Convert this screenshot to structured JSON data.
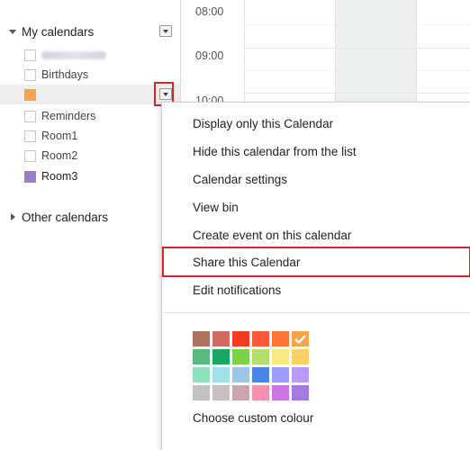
{
  "sidebar": {
    "my_calendars_label": "My calendars",
    "other_calendars_label": "Other calendars",
    "calendars": [
      {
        "label": "",
        "redacted": true,
        "color": "#ffffff"
      },
      {
        "label": "Birthdays",
        "color": "#ffffff"
      },
      {
        "label": "",
        "color": "#f6a44a"
      },
      {
        "label": "Reminders",
        "color": "#ffffff"
      },
      {
        "label": "Room1",
        "color": "#ffffff"
      },
      {
        "label": "Room2",
        "color": "#ffffff"
      },
      {
        "label": "Room3",
        "color": "#9a7fc4"
      }
    ]
  },
  "grid": {
    "times": [
      "08:00",
      "09:00",
      "10:00"
    ]
  },
  "menu": {
    "items": [
      "Display only this Calendar",
      "Hide this calendar from the list",
      "Calendar settings",
      "View bin",
      "Create event on this calendar",
      "Share this Calendar",
      "Edit notifications"
    ],
    "custom_colour_label": "Choose custom colour",
    "selected_color": "#f6a44a",
    "palette": [
      [
        "#ac725e",
        "#d06b64",
        "#f83a22",
        "#fa573c",
        "#ff7537",
        "#f6a44a"
      ],
      [
        "#5aba7e",
        "#16a765",
        "#7bd148",
        "#b3dc6c",
        "#fbe983",
        "#fad165"
      ],
      [
        "#92e1c0",
        "#9fe1e7",
        "#9fc6e7",
        "#4986e7",
        "#9a9cff",
        "#b99aff"
      ],
      [
        "#c2c2c2",
        "#cabdbf",
        "#cca6ac",
        "#f691b2",
        "#cd74e6",
        "#a47ae2"
      ]
    ]
  }
}
